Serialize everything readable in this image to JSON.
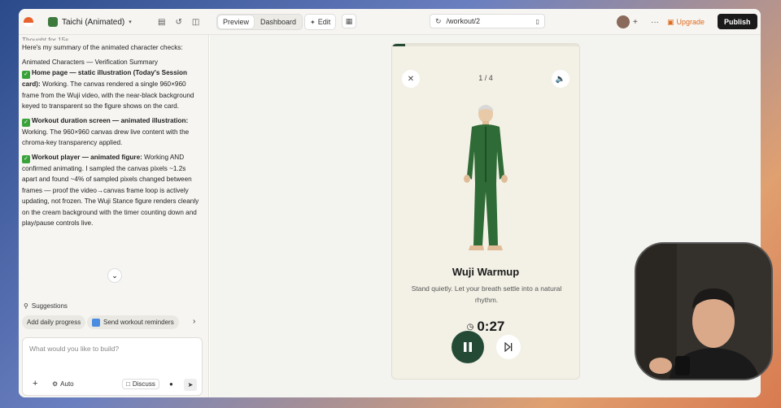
{
  "project": {
    "name": "Taichi (Animated)"
  },
  "tabs": [
    {
      "label": "Preview",
      "active": true
    },
    {
      "label": "Dashboard",
      "active": false
    }
  ],
  "edit_label": "Edit",
  "url": "/workout/2",
  "upgrade_label": "Upgrade",
  "publish_label": "Publish",
  "chat": {
    "thought_label": "Thought for 15s",
    "intro": "Here's my summary of the animated character checks:",
    "heading": "Animated Characters — Verification Summary",
    "items": [
      {
        "title": "Home page — static illustration (Today's Session card):",
        "body": " Working. The canvas rendered a single 960×960 frame from the Wuji video, with the near-black background keyed to transparent so the figure shows on the card."
      },
      {
        "title": "Workout duration screen — animated illustration:",
        "body": " Working. The 960×960 canvas drew live content with the chroma-key transparency applied."
      },
      {
        "title": "Workout player — animated figure:",
        "body": " Working AND confirmed animating. I sampled the canvas pixels ~1.2s apart and found ~4% of sampled pixels changed between frames — proof the video→canvas frame loop is actively updating, not frozen. The Wuji Stance figure renders cleanly on the cream background with the timer counting down and play/pause controls live."
      }
    ]
  },
  "suggestions": {
    "title": "Suggestions",
    "chips": [
      "Add daily progress",
      "Send workout reminders"
    ]
  },
  "composer": {
    "placeholder": "What would you like to build?",
    "mode": "Auto",
    "discuss": "Discuss"
  },
  "player": {
    "counter": "1 / 4",
    "title": "Wuji Warmup",
    "description": "Stand quietly. Let your breath settle into a natural rhythm.",
    "timer": "0:27",
    "progress": 0.07
  },
  "colors": {
    "accent": "#244a36",
    "upgrade": "#e06a1e",
    "publish_bg": "#1a1a1a"
  }
}
